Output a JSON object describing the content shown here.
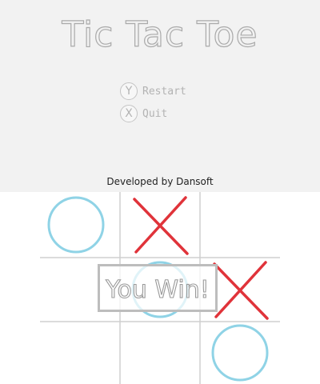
{
  "title": "Tic Tac Toe",
  "menu": [
    {
      "button": "Y",
      "label": "Restart"
    },
    {
      "button": "X",
      "label": "Quit"
    }
  ],
  "credits": "Developed by Dansoft",
  "board": [
    [
      "O",
      "X",
      ""
    ],
    [
      "",
      "O",
      "X"
    ],
    [
      "",
      "",
      "O"
    ]
  ],
  "result": "You Win!",
  "colors": {
    "o": "#8fd3e6",
    "x": "#e0333a",
    "grid": "#cfcfcf"
  }
}
